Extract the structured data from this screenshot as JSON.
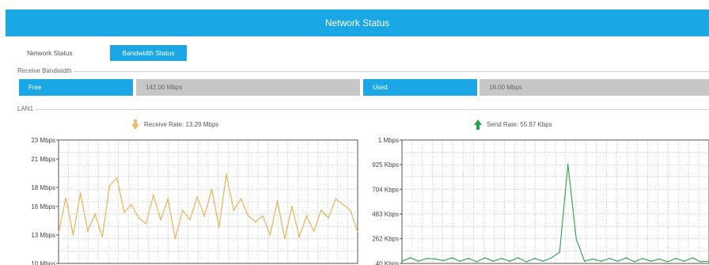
{
  "header": {
    "title": "Network Status"
  },
  "tabs": [
    {
      "label": "Network Status",
      "active": false
    },
    {
      "label": "Bandwidth Status",
      "active": true
    }
  ],
  "receive_bandwidth": {
    "section_label": "Receive Bandwidth",
    "free_label": "Free",
    "free_value": "142.00 Mbps",
    "used_label": "Used",
    "used_value": "18.00 Mbps"
  },
  "lan": {
    "section_label": "LAN1",
    "receive_rate_text": "Receive Rate: 13.29 Mbps",
    "send_rate_text": "Send Rate: 55.97 Kbps"
  },
  "colors": {
    "accent": "#1aa7e6",
    "bar_gray": "#c7c7c7",
    "receive_line": "#e8b25a",
    "send_line": "#3aa55a",
    "receive_arrow": "#f2b96b",
    "send_arrow": "#2e9e4a"
  },
  "chart_data": [
    {
      "type": "line",
      "title": "Receive Rate: 13.29 Mbps",
      "xlabel": "",
      "ylabel": "",
      "y_tick_labels": [
        "23 Mbps",
        "21 Mbps",
        "18 Mbps",
        "16 Mbps",
        "13 Mbps",
        "10 Mbps"
      ],
      "y_tick_values": [
        23,
        21,
        18,
        16,
        13,
        10
      ],
      "ylim": [
        10,
        23
      ],
      "grid": true,
      "series": [
        {
          "values": [
            13.2,
            16.9,
            13.0,
            17.4,
            13.4,
            15.2,
            12.8,
            18.2,
            19.0,
            15.4,
            16.2,
            14.8,
            14.2,
            17.2,
            14.6,
            16.8,
            12.6,
            15.6,
            14.6,
            17.0,
            15.0,
            17.8,
            13.8,
            19.4,
            15.6,
            16.8,
            15.0,
            14.4,
            15.0,
            13.0,
            16.6,
            12.6,
            16.0,
            12.8,
            15.0,
            13.4,
            15.6,
            14.8,
            16.8,
            16.2,
            15.6,
            13.3
          ]
        }
      ]
    },
    {
      "type": "line",
      "title": "Send Rate: 55.97 Kbps",
      "xlabel": "",
      "ylabel": "",
      "y_tick_labels": [
        "1 Mbps",
        "925 Kbps",
        "704 Kbps",
        "483 Kbps",
        "262 Kbps",
        "40 Kbps"
      ],
      "y_tick_values": [
        1146,
        925,
        704,
        483,
        262,
        40
      ],
      "ylim": [
        40,
        1146
      ],
      "grid": true,
      "series": [
        {
          "values": [
            60,
            90,
            60,
            85,
            80,
            65,
            90,
            60,
            85,
            55,
            90,
            60,
            85,
            60,
            90,
            55,
            85,
            60,
            90,
            140,
            930,
            260,
            60,
            80,
            60,
            85,
            60,
            90,
            55,
            85,
            60,
            80,
            55,
            85,
            60,
            90,
            55,
            60
          ]
        }
      ]
    }
  ]
}
